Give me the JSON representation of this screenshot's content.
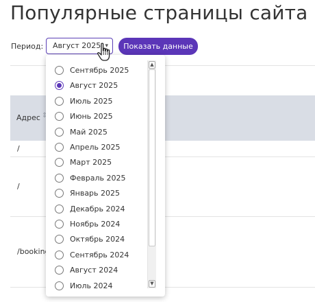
{
  "page": {
    "title": "Популярные страницы сайта"
  },
  "filter": {
    "period_label": "Период:",
    "selected_period": "Август 2025",
    "submit_label": "Показать данные"
  },
  "table": {
    "header": {
      "address": "Адрес"
    },
    "rows": [
      "/",
      "/",
      "/booking"
    ]
  },
  "dropdown": {
    "options": [
      {
        "label": "Сентябрь 2025",
        "selected": false
      },
      {
        "label": "Август 2025",
        "selected": true
      },
      {
        "label": "Июль 2025",
        "selected": false
      },
      {
        "label": "Июнь 2025",
        "selected": false
      },
      {
        "label": "Май 2025",
        "selected": false
      },
      {
        "label": "Апрель 2025",
        "selected": false
      },
      {
        "label": "Март 2025",
        "selected": false
      },
      {
        "label": "Февраль 2025",
        "selected": false
      },
      {
        "label": "Январь 2025",
        "selected": false
      },
      {
        "label": "Декабрь 2024",
        "selected": false
      },
      {
        "label": "Ноябрь 2024",
        "selected": false
      },
      {
        "label": "Октябрь 2024",
        "selected": false
      },
      {
        "label": "Сентябрь 2024",
        "selected": false
      },
      {
        "label": "Август 2024",
        "selected": false
      },
      {
        "label": "Июль 2024",
        "selected": false
      }
    ]
  },
  "colors": {
    "accent": "#5b36b8",
    "table_header_bg": "#d9dde5"
  }
}
